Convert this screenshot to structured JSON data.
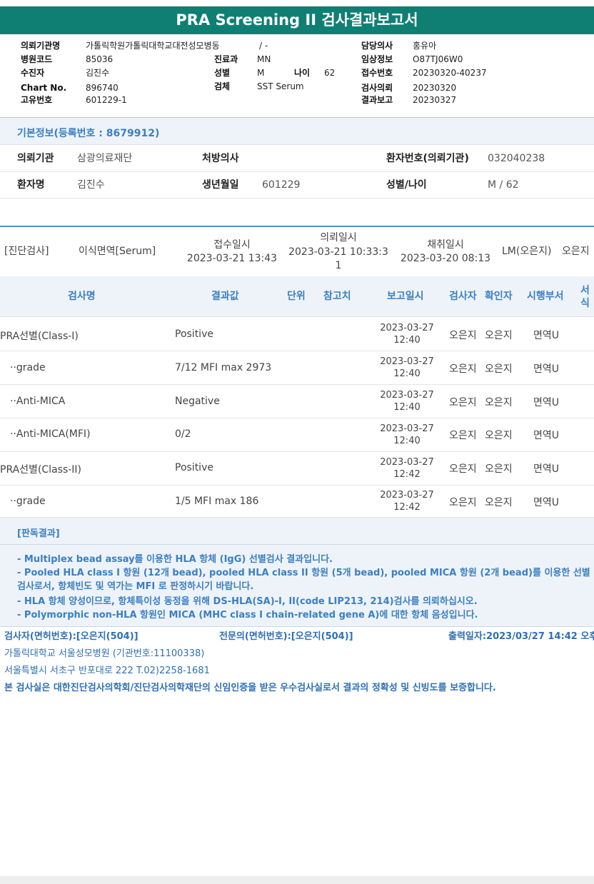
{
  "title": "PRA Screening II 검사결과보고서",
  "report_header": {
    "institution_label": "의뢰기관명",
    "institution_value": "가톨릭학원가톨릭대학교대전성모병동",
    "institution_extra": "/ -",
    "hospital_code_label": "병원코드",
    "hospital_code_value": "85036",
    "patient_label": "수진자",
    "patient_value": "김진수",
    "chart_label": "Chart No.",
    "chart_value": "896740",
    "unique_label": "고유번호",
    "unique_value": "601229-1",
    "dept_label": "진료과",
    "dept_value": "MN",
    "sex_label": "성별",
    "sex_value": "M",
    "age_label": "나이",
    "age_value": "62",
    "specimen_label": "검체",
    "specimen_value": "SST Serum",
    "doctor_label": "담당의사",
    "doctor_value": "홍유아",
    "clinical_label": "임상정보",
    "clinical_value": "O87TJ06W0",
    "receipt_label": "접수번호",
    "receipt_value": "20230320-40237",
    "requested_label": "검사의뢰",
    "requested_value": "20230320",
    "reported_label": "결과보고",
    "reported_value": "20230327"
  },
  "basic_info": {
    "title": "기본정보(등록번호 : 8679912)",
    "institution_label": "의뢰기관",
    "institution_value": "삼광의료재단",
    "prescriber_label": "처방의사",
    "prescriber_value": "",
    "patient_no_label": "환자번호(의뢰기관)",
    "patient_no_value": "032040238",
    "name_label": "환자명",
    "name_value": "김진수",
    "birth_label": "생년월일",
    "birth_value": "601229",
    "sexage_label": "성별/나이",
    "sexage_value": "M / 62"
  },
  "diagnosis": {
    "category": "[진단검사]",
    "test": "이식면역[Serum]",
    "received_label": "접수일시",
    "received_value": "2023-03-21 13:43",
    "requested_label": "의뢰일시",
    "requested_value_1": "2023-03-21 10:33:3",
    "requested_value_2": "1",
    "collected_label": "채취일시",
    "collected_value": "2023-03-20 08:13",
    "staff": "LM(오은지)",
    "staff2": "오은지"
  },
  "results": {
    "headers": {
      "name": "검사명",
      "value": "결과값",
      "unit": "단위",
      "reference": "참고치",
      "report_date": "보고일시",
      "tester": "검사자",
      "confirmer": "확인자",
      "dept": "시행부서",
      "format_1": "서",
      "format_2": "식"
    },
    "rows": [
      {
        "name": "PRA선별(Class-I)",
        "value": "Positive",
        "date": "2023-03-27",
        "time": "12:40",
        "tester": "오은지",
        "confirmer": "오은지",
        "dept": "면역U"
      },
      {
        "name": "··grade",
        "value": "7/12 MFI max 2973",
        "date": "2023-03-27",
        "time": "12:40",
        "tester": "오은지",
        "confirmer": "오은지",
        "dept": "면역U"
      },
      {
        "name": "··Anti-MICA",
        "value": "Negative",
        "date": "2023-03-27",
        "time": "12:40",
        "tester": "오은지",
        "confirmer": "오은지",
        "dept": "면역U"
      },
      {
        "name": "··Anti-MICA(MFI)",
        "value": "0/2",
        "date": "2023-03-27",
        "time": "12:40",
        "tester": "오은지",
        "confirmer": "오은지",
        "dept": "면역U"
      },
      {
        "name": "PRA선별(Class-II)",
        "value": "Positive",
        "date": "2023-03-27",
        "time": "12:42",
        "tester": "오은지",
        "confirmer": "오은지",
        "dept": "면역U"
      },
      {
        "name": "··grade",
        "value": "1/5 MFI max 186",
        "date": "2023-03-27",
        "time": "12:42",
        "tester": "오은지",
        "confirmer": "오은지",
        "dept": "면역U"
      }
    ]
  },
  "judgement": {
    "title": "[판독결과]",
    "lines": [
      "- Multiplex bead assay를 이용한 HLA 항체 (IgG) 선별검사 결과입니다.",
      "- Pooled HLA class I 항원 (12개 bead), pooled HLA class II 항원 (5개 bead), pooled MICA 항원 (2개 bead)를 이용한 선별",
      "검사로서, 항체빈도 및 역가는 MFI 로 판정하시기 바랍니다.",
      "- HLA 항체 양성이므로, 항체특이성 동정을 위해 DS-HLA(SA)-I, II(code LIP213, 214)검사를 의뢰하십시오.",
      "- Polymorphic non-HLA 항원인 MICA (MHC class I chain-related gene A)에 대한 항체 음성입니다."
    ]
  },
  "footer": {
    "tester": "검사자(면허번호):[오은지(504)]",
    "specialist": "전문의(면허번호):[오은지(504)]",
    "printed": "출력일자:2023/03/27 14:42 오후",
    "hospital": "가톨릭대학교 서울성모병원 (기관번호:11100338)",
    "address": "서울특별시 서초구 반포대로 222 T.02)2258-1681",
    "certification": "본 검사실은 대한진단검사의학회/진단검사의학재단의 신임인증을 받은 우수검사실로서 결과의 정확성 및 신빙도를 보증합니다."
  },
  "colors": {
    "title_bar": "#0f7f74",
    "accent_blue": "#3a7fc3",
    "section_bg": "#eef3f9"
  }
}
